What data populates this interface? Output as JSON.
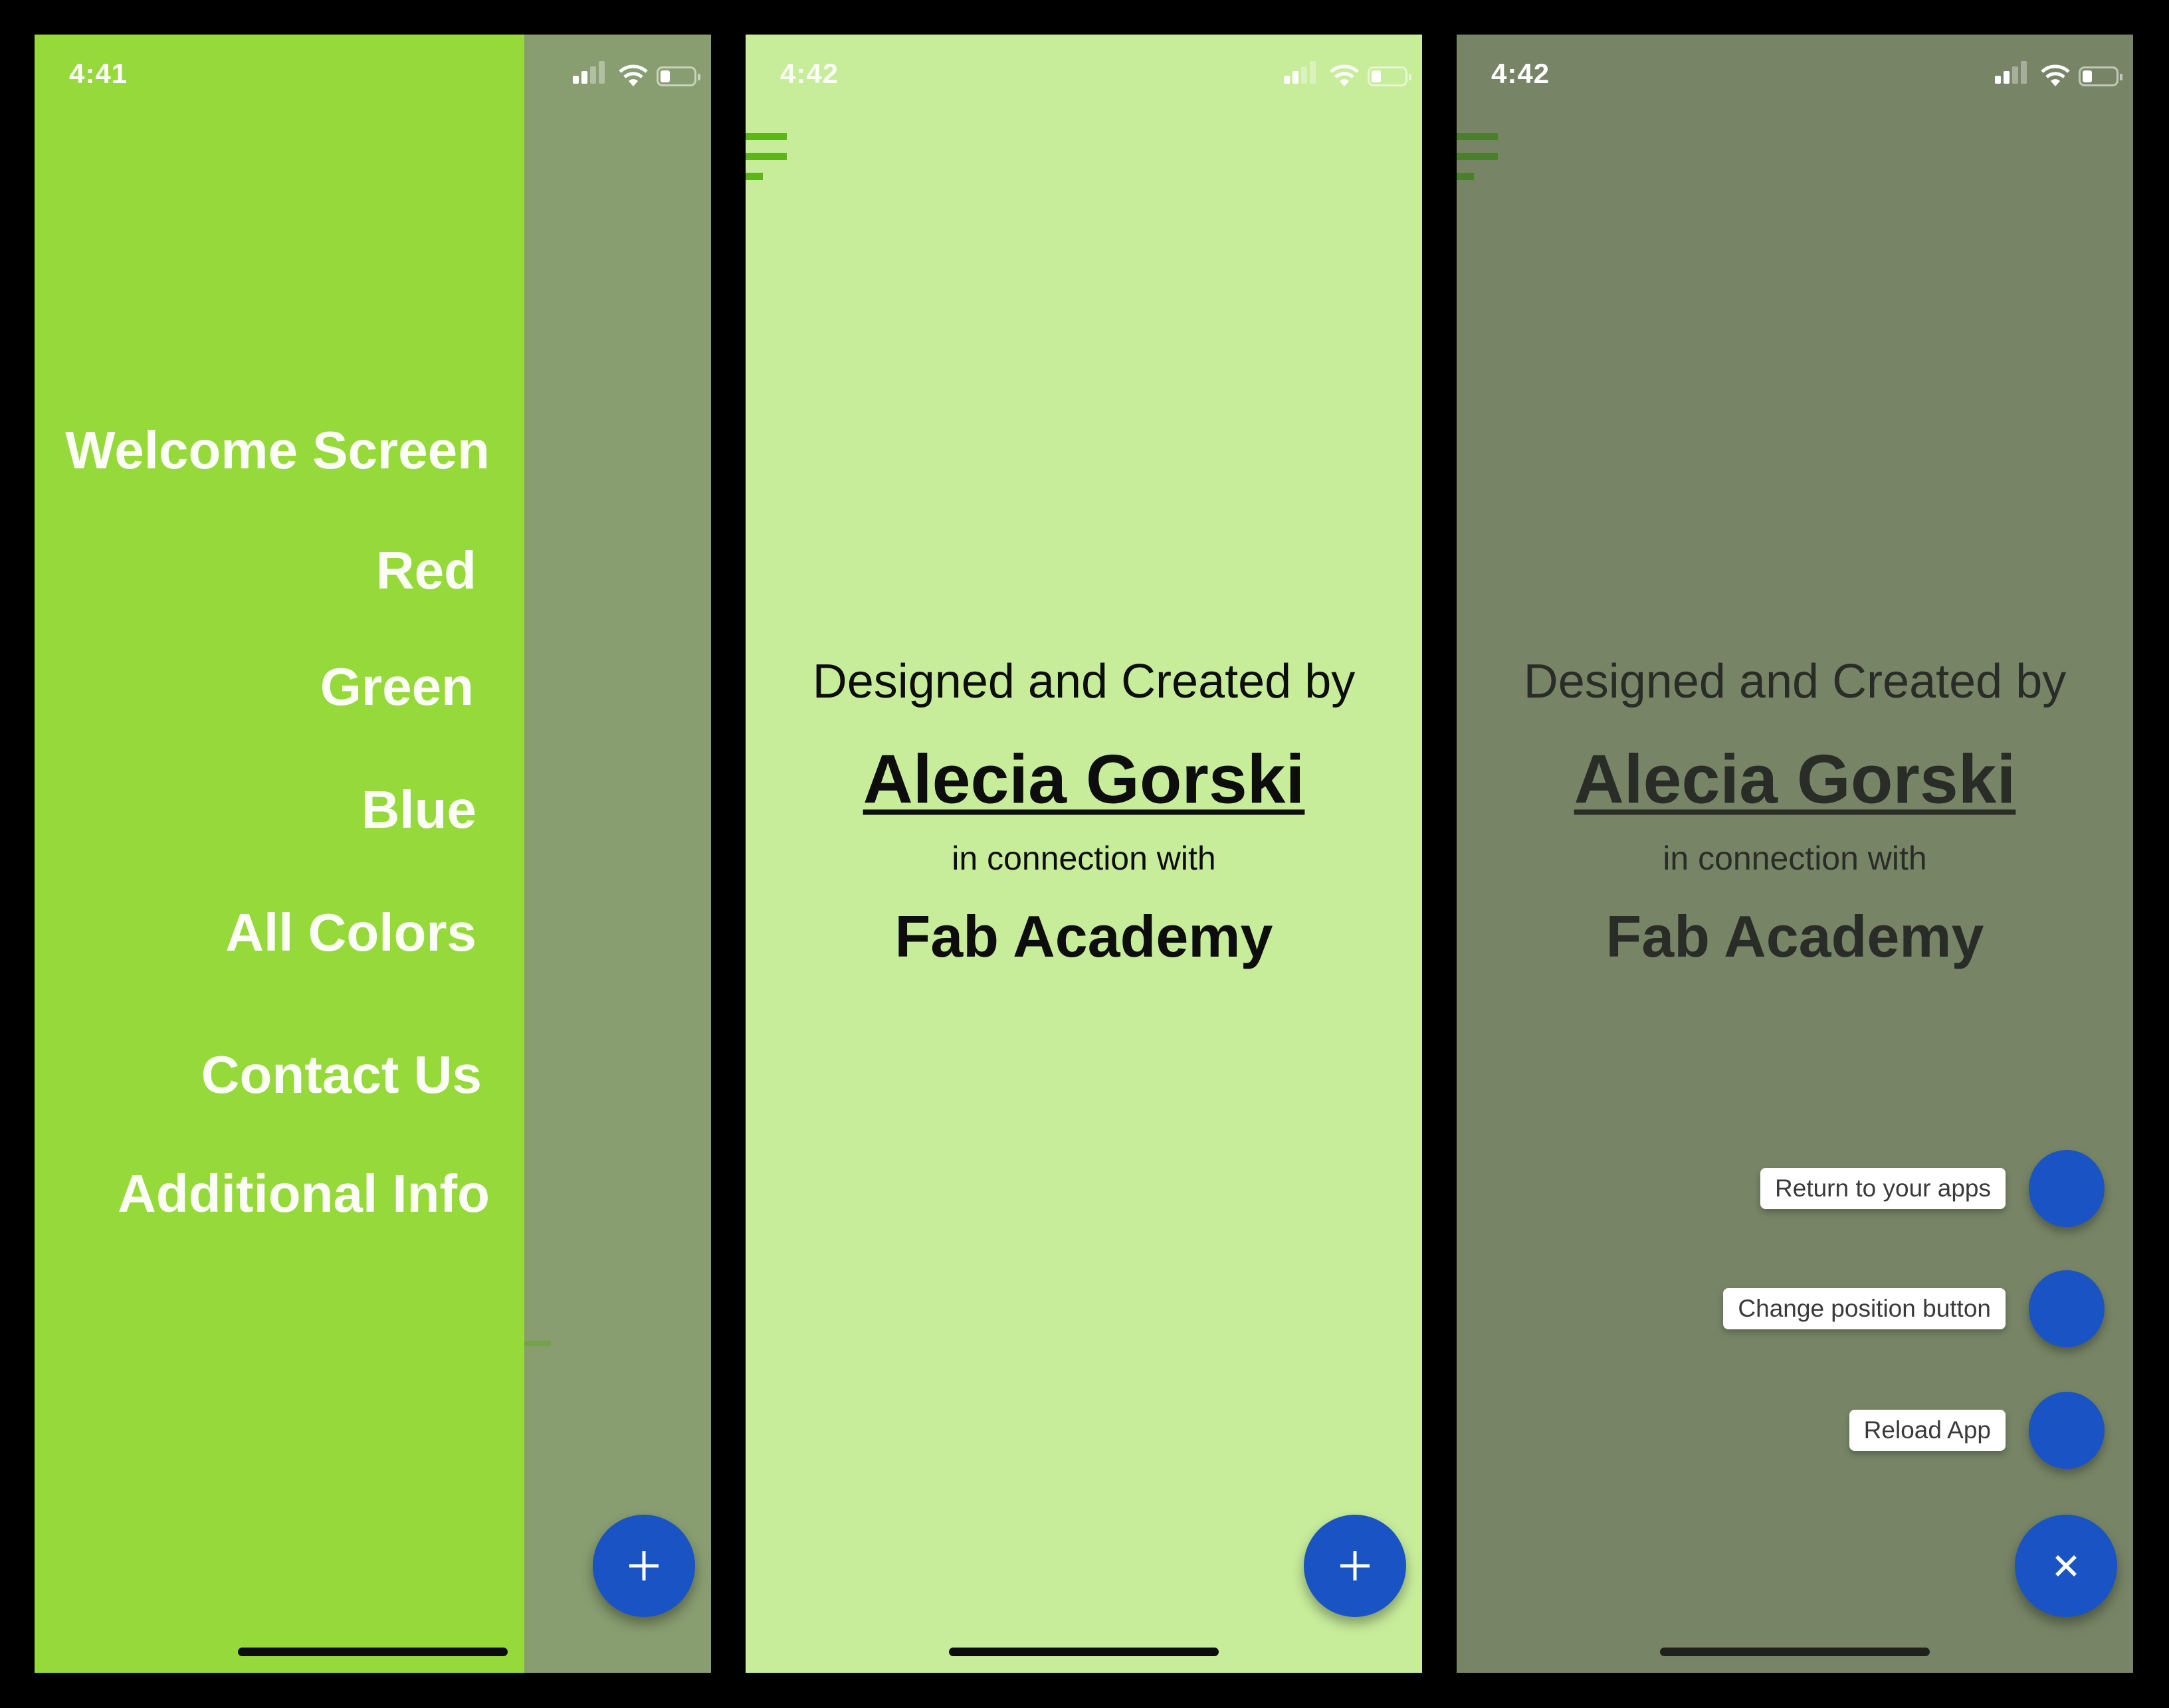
{
  "screens": [
    {
      "id": "drawer-open",
      "status_bar": {
        "time": "4:41"
      },
      "drawer": {
        "items": [
          {
            "label": "Welcome Screen"
          },
          {
            "label": "Red"
          },
          {
            "label": "Green"
          },
          {
            "label": "Blue"
          },
          {
            "label": "All Colors"
          },
          {
            "label": "Contact Us"
          },
          {
            "label": "Additional Info"
          }
        ]
      },
      "fab": {
        "icon": "plus-icon",
        "glyph": "+"
      }
    },
    {
      "id": "credits",
      "status_bar": {
        "time": "4:42"
      },
      "menu_icon": "hamburger-menu-icon",
      "credits": {
        "intro": "Designed and Created by",
        "author": "Alecia Gorski",
        "connector": "in connection with",
        "organization": "Fab Academy"
      },
      "fab": {
        "icon": "plus-icon",
        "glyph": "+"
      }
    },
    {
      "id": "credits-speed-dial-open",
      "status_bar": {
        "time": "4:42"
      },
      "menu_icon": "hamburger-menu-icon",
      "credits": {
        "intro": "Designed and Created by",
        "author": "Alecia Gorski",
        "connector": "in connection with",
        "organization": "Fab Academy"
      },
      "speed_dial": {
        "actions": [
          {
            "label": "Return to your apps"
          },
          {
            "label": "Change position button"
          },
          {
            "label": "Reload App"
          }
        ]
      },
      "fab": {
        "icon": "close-icon",
        "glyph": "×"
      }
    }
  ],
  "colors": {
    "drawer_green": "#95d93a",
    "screen_light_green": "#c7ed9b",
    "scrim_dimmed": "#778566",
    "fab_blue": "#1953c4",
    "hamburger_green": "#5cb51b"
  }
}
